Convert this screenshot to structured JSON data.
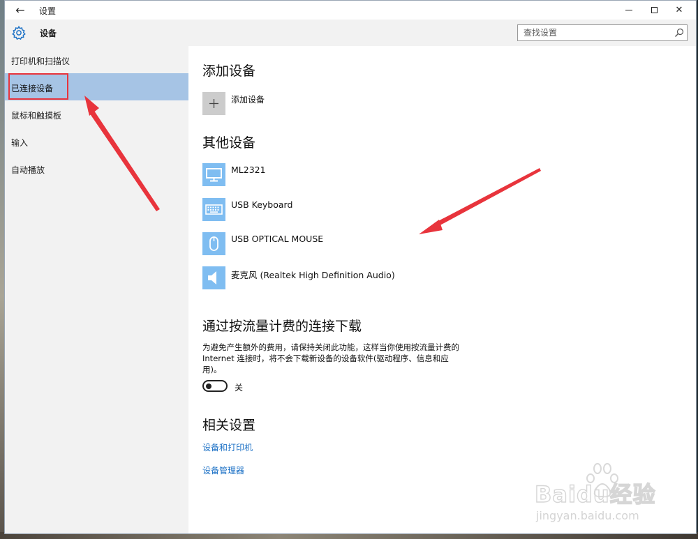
{
  "window": {
    "title": "设置",
    "back_glyph": "←",
    "close_glyph": "✕"
  },
  "header": {
    "title": "设备",
    "icon": "gear-icon",
    "search_placeholder": "查找设置"
  },
  "sidebar": {
    "items": [
      {
        "label": "打印机和扫描仪",
        "selected": false
      },
      {
        "label": "已连接设备",
        "selected": true
      },
      {
        "label": "鼠标和触摸板",
        "selected": false
      },
      {
        "label": "输入",
        "selected": false
      },
      {
        "label": "自动播放",
        "selected": false
      }
    ]
  },
  "main": {
    "add_section": {
      "heading": "添加设备",
      "add_button_label": "添加设备",
      "add_glyph": "+"
    },
    "other_section": {
      "heading": "其他设备",
      "devices": [
        {
          "name": "ML2321",
          "icon": "monitor-icon"
        },
        {
          "name": "USB Keyboard",
          "icon": "keyboard-icon"
        },
        {
          "name": "USB OPTICAL MOUSE",
          "icon": "mouse-icon"
        },
        {
          "name": "麦克风 (Realtek High Definition Audio)",
          "icon": "speaker-icon"
        }
      ]
    },
    "metered_section": {
      "heading": "通过按流量计费的连接下载",
      "description": "为避免产生额外的费用，请保持关闭此功能，这样当你使用按流量计费的 Internet 连接时，将不会下载新设备的设备软件(驱动程序、信息和应用)。",
      "toggle_state": "关"
    },
    "related_section": {
      "heading": "相关设置",
      "links": [
        "设备和打印机",
        "设备管理器"
      ]
    }
  },
  "colors": {
    "accent": "#7fbdf1",
    "selected_bg": "#a6c4e5",
    "link": "#1e72c6",
    "annotation": "#e8343c"
  },
  "watermark": {
    "brand": "Baidu经验",
    "url": "jingyan.baidu.com"
  }
}
